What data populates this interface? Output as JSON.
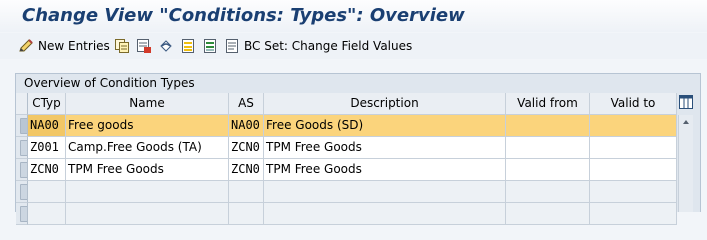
{
  "window": {
    "title": "Change View \"Conditions: Types\": Overview"
  },
  "toolbar": {
    "new_entries_label": "New Entries",
    "bc_set_label": "BC Set: Change Field Values"
  },
  "panel": {
    "title": "Overview of Condition Types"
  },
  "table": {
    "columns": [
      "CTyp",
      "Name",
      "AS",
      "Description",
      "Valid from",
      "Valid to"
    ],
    "rows": [
      {
        "ctyp": "NA00",
        "name": "Free goods",
        "as": "NA00",
        "description": "Free Goods (SD)",
        "valid_from": "",
        "valid_to": ""
      },
      {
        "ctyp": "Z001",
        "name": "Camp.Free Goods (TA)",
        "as": "ZCN0",
        "description": "TPM Free Goods",
        "valid_from": "",
        "valid_to": ""
      },
      {
        "ctyp": "ZCN0",
        "name": "TPM Free Goods",
        "as": "ZCN0",
        "description": "TPM Free Goods",
        "valid_from": "",
        "valid_to": ""
      }
    ]
  },
  "colors": {
    "title_blue": "#1a3f72",
    "selected_row": "#fbd47c",
    "panel_bg": "#dfe6ee"
  }
}
